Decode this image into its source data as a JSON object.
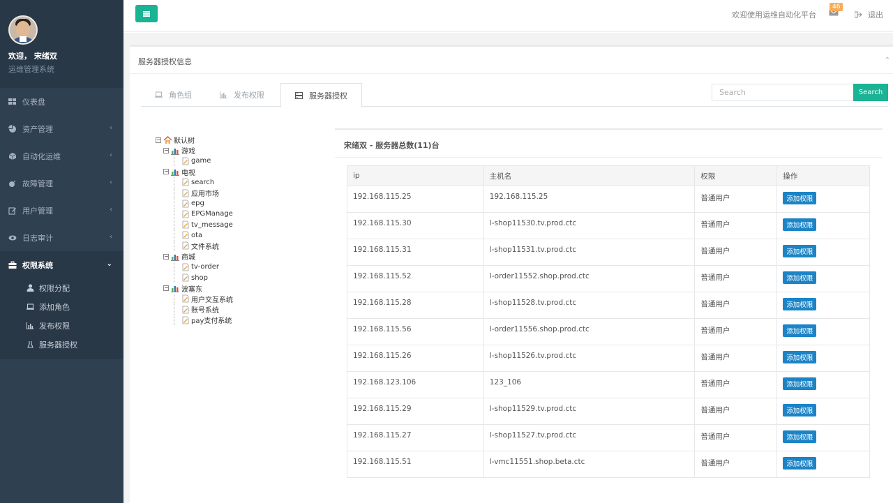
{
  "sidebar": {
    "welcome": "欢迎， 宋绪双",
    "subtitle": "运维管理系统",
    "items": [
      {
        "label": "仪表盘",
        "icon": "grid-icon",
        "has_arrow": false
      },
      {
        "label": "资产管理",
        "icon": "chart-pie-icon",
        "has_arrow": true
      },
      {
        "label": "自动化运维",
        "icon": "cube-icon",
        "has_arrow": true
      },
      {
        "label": "故障管理",
        "icon": "bomb-icon",
        "has_arrow": true
      },
      {
        "label": "用户管理",
        "icon": "edit-icon",
        "has_arrow": true
      },
      {
        "label": "日志审计",
        "icon": "eye-icon",
        "has_arrow": true
      },
      {
        "label": "权限系统",
        "icon": "briefcase-icon",
        "has_arrow": true,
        "expanded": true
      }
    ],
    "sub_items": [
      {
        "label": "权限分配",
        "icon": "user-icon"
      },
      {
        "label": "添加角色",
        "icon": "laptop-icon"
      },
      {
        "label": "发布权限",
        "icon": "bar-chart-icon"
      },
      {
        "label": "服务器授权",
        "icon": "flask-icon"
      }
    ]
  },
  "topbar": {
    "welcome": "欢迎使用运维自动化平台",
    "mail_badge": "46",
    "logout": "退出"
  },
  "panel": {
    "title": "服务器授权信息",
    "tabs": [
      {
        "label": "角色组",
        "icon": "laptop-icon"
      },
      {
        "label": "发布权限",
        "icon": "bar-chart-icon"
      },
      {
        "label": "服务器授权",
        "icon": "server-icon",
        "active": true
      }
    ],
    "search_placeholder": "Search",
    "search_button": "Search"
  },
  "tree": {
    "root": "默认树",
    "groups": [
      {
        "label": "游戏",
        "children": [
          "game"
        ]
      },
      {
        "label": "电视",
        "children": [
          "search",
          "应用市场",
          "epg",
          "EPGManage",
          "tv_message",
          "ota",
          "文件系统"
        ]
      },
      {
        "label": "商城",
        "children": [
          "tv-order",
          "shop"
        ]
      },
      {
        "label": "波塞东",
        "children": [
          "用户交互系统",
          "账号系统",
          "pay支付系统"
        ]
      }
    ]
  },
  "detail": {
    "title": "宋绪双 - 服务器总数(11)台",
    "columns": [
      "ip",
      "主机名",
      "权限",
      "操作"
    ],
    "action_label": "添加权限",
    "rows": [
      {
        "ip": "192.168.115.25",
        "host": "192.168.115.25",
        "perm": "普通用户"
      },
      {
        "ip": "192.168.115.30",
        "host": "l-shop11530.tv.prod.ctc",
        "perm": "普通用户"
      },
      {
        "ip": "192.168.115.31",
        "host": "l-shop11531.tv.prod.ctc",
        "perm": "普通用户"
      },
      {
        "ip": "192.168.115.52",
        "host": "l-order11552.shop.prod.ctc",
        "perm": "普通用户"
      },
      {
        "ip": "192.168.115.28",
        "host": "l-shop11528.tv.prod.ctc",
        "perm": "普通用户"
      },
      {
        "ip": "192.168.115.56",
        "host": "l-order11556.shop.prod.ctc",
        "perm": "普通用户"
      },
      {
        "ip": "192.168.115.26",
        "host": "l-shop11526.tv.prod.ctc",
        "perm": "普通用户"
      },
      {
        "ip": "192.168.123.106",
        "host": "123_106",
        "perm": "普通用户"
      },
      {
        "ip": "192.168.115.29",
        "host": "l-shop11529.tv.prod.ctc",
        "perm": "普通用户"
      },
      {
        "ip": "192.168.115.27",
        "host": "l-shop11527.tv.prod.ctc",
        "perm": "普通用户"
      },
      {
        "ip": "192.168.115.51",
        "host": "l-vmc11551.shop.beta.ctc",
        "perm": "普通用户"
      }
    ]
  },
  "colors": {
    "sidebar_bg": "#2f4050",
    "accent": "#1ab394",
    "action_blue": "#1c84c6",
    "badge": "#f8ac59"
  }
}
